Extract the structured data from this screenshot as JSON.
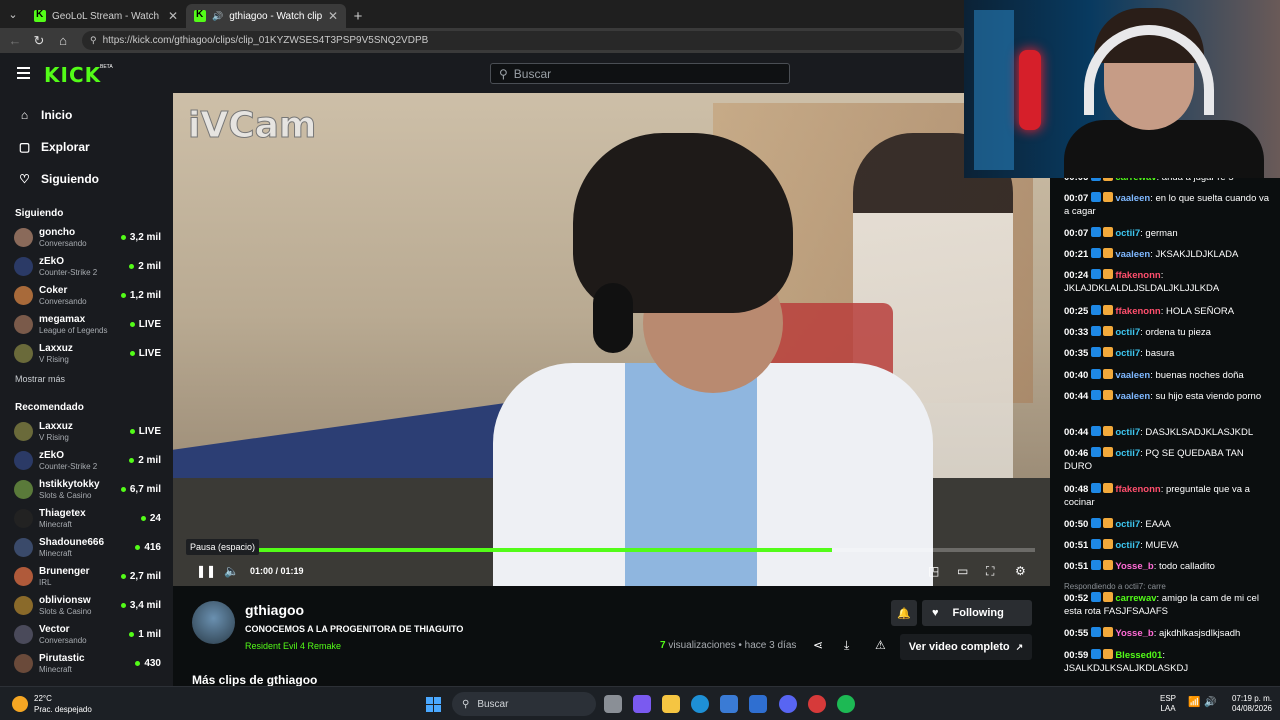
{
  "browser": {
    "tabs": [
      {
        "title": "GeoLoL Stream - Watch Live on K",
        "active": false
      },
      {
        "title": "gthiagoo - Watch clips on Kick",
        "active": true
      }
    ],
    "url": "https://kick.com/gthiagoo/clips/clip_01KYZWSES4T3PSP9V5SNQ2VDPB"
  },
  "header": {
    "logo": "KICK",
    "beta": "BETA",
    "search_placeholder": "Buscar"
  },
  "sidebar": {
    "nav": [
      {
        "label": "Inicio",
        "icon": "home-icon"
      },
      {
        "label": "Explorar",
        "icon": "compass-icon"
      },
      {
        "label": "Siguiendo",
        "icon": "heart-icon"
      }
    ],
    "following_title": "Siguiendo",
    "following": [
      {
        "name": "goncho",
        "category": "Conversando",
        "viewers": "3,2 mil",
        "color": "#8a6a5a"
      },
      {
        "name": "zEkO",
        "category": "Counter-Strike 2",
        "viewers": "2 mil",
        "color": "#2b3a66"
      },
      {
        "name": "Coker",
        "category": "Conversando",
        "viewers": "1,2 mil",
        "color": "#a86a3a"
      },
      {
        "name": "megamax",
        "category": "League of Legends",
        "viewers": "LIVE",
        "color": "#7a5a4a"
      },
      {
        "name": "Laxxuz",
        "category": "V Rising",
        "viewers": "LIVE",
        "color": "#6a6a3a"
      }
    ],
    "show_more": "Mostrar más",
    "recommended_title": "Recomendado",
    "recommended": [
      {
        "name": "Laxxuz",
        "category": "V Rising",
        "viewers": "LIVE",
        "color": "#6a6a3a"
      },
      {
        "name": "zEkO",
        "category": "Counter-Strike 2",
        "viewers": "2 mil",
        "color": "#2b3a66"
      },
      {
        "name": "hstikkytokky",
        "category": "Slots & Casino",
        "viewers": "6,7 mil",
        "color": "#5a7a3a"
      },
      {
        "name": "Thiagetex",
        "category": "Minecraft",
        "viewers": "24",
        "color": "#222222"
      },
      {
        "name": "Shadoune666",
        "category": "Minecraft",
        "viewers": "416",
        "color": "#3a4a6a"
      },
      {
        "name": "Brunenger",
        "category": "IRL",
        "viewers": "2,7 mil",
        "color": "#b05a3a"
      },
      {
        "name": "oblivionsw",
        "category": "Slots & Casino",
        "viewers": "3,4 mil",
        "color": "#8a6a2a"
      },
      {
        "name": "Vector",
        "category": "Conversando",
        "viewers": "1 mil",
        "color": "#4a4a5a"
      },
      {
        "name": "Pirutastic",
        "category": "Minecraft",
        "viewers": "430",
        "color": "#6a4a3a"
      }
    ]
  },
  "video": {
    "watermark": "iVCam",
    "tooltip": "Pausa (espacio)",
    "time": "01:00 / 01:19",
    "progress": 0.76
  },
  "clip": {
    "channel": "gthiagoo",
    "title": "CONOCEMOS A LA PROGENITORA DE THIAGUITO",
    "category": "Resident Evil 4 Remake",
    "follow_label": "Following",
    "views_count": "7",
    "views_label": "visualizaciones",
    "ago": "• hace 3 días",
    "full_video": "Ver video completo",
    "more_clips": "Más clips de gthiagoo"
  },
  "chat": {
    "messages": [
      {
        "time": "00:06",
        "user": "carrewav",
        "text": "anda a jugar re 5",
        "color": "#53fc18"
      },
      {
        "time": "00:07",
        "user": "vaaleen",
        "text": "en lo que suelta cuando va a cagar",
        "color": "#7fb8ff"
      },
      {
        "time": "00:07",
        "user": "octii7",
        "text": "german",
        "color": "#3ec6f0"
      },
      {
        "time": "00:21",
        "user": "vaaleen",
        "text": "JKSAKJLDJKLADA",
        "color": "#7fb8ff"
      },
      {
        "time": "00:24",
        "user": "ffakenonn",
        "text": "JKLAJDKLALDLJSLDALJKLJJLKDA",
        "color": "#ff4f6d"
      },
      {
        "time": "00:25",
        "user": "ffakenonn",
        "text": "HOLA SEÑORA",
        "color": "#ff4f6d"
      },
      {
        "time": "00:33",
        "user": "octii7",
        "text": "ordena tu pieza",
        "color": "#3ec6f0"
      },
      {
        "time": "00:35",
        "user": "octii7",
        "text": "basura",
        "color": "#3ec6f0"
      },
      {
        "time": "00:40",
        "user": "vaaleen",
        "text": "buenas noches doña",
        "color": "#7fb8ff"
      },
      {
        "time": "00:44",
        "user": "vaaleen",
        "text": "su hijo esta viendo porno",
        "color": "#7fb8ff"
      },
      {
        "time": "00:44",
        "user": "octii7",
        "text": "DASJKLSADJKLASJKDL",
        "color": "#3ec6f0"
      },
      {
        "time": "00:46",
        "user": "octii7",
        "text": "PQ SE QUEDABA TAN DURO",
        "color": "#3ec6f0"
      },
      {
        "time": "00:48",
        "user": "ffakenonn",
        "text": "preguntale que va a cocinar",
        "color": "#ff4f6d"
      },
      {
        "time": "00:50",
        "user": "octii7",
        "text": "EAAA",
        "color": "#3ec6f0"
      },
      {
        "time": "00:51",
        "user": "octii7",
        "text": "MUEVA",
        "color": "#3ec6f0"
      },
      {
        "time": "00:51",
        "user": "Yosse_b",
        "text": "todo calladito",
        "color": "#ff6bd6"
      },
      {
        "time": "00:52",
        "user": "carrewav",
        "text": "amigo la cam de mi cel esta rota FASJFSAJAFS",
        "color": "#53fc18"
      },
      {
        "time": "00:55",
        "user": "Yosse_b",
        "text": "ajkdhlkasjsdlkjsadh",
        "color": "#ff6bd6"
      },
      {
        "time": "00:59",
        "user": "Blessed01",
        "text": "JSALKDJLKSALJKDLASKDJ",
        "color": "#53fc18"
      }
    ],
    "reply_note": "Respondiendo a octii7: carre"
  },
  "taskbar": {
    "temp": "22°C",
    "weather": "Prac. despejado",
    "search": "Buscar",
    "lang1": "ESP",
    "lang2": "LAA",
    "time": "07:19 p. m.",
    "date": "04/08/2026"
  }
}
